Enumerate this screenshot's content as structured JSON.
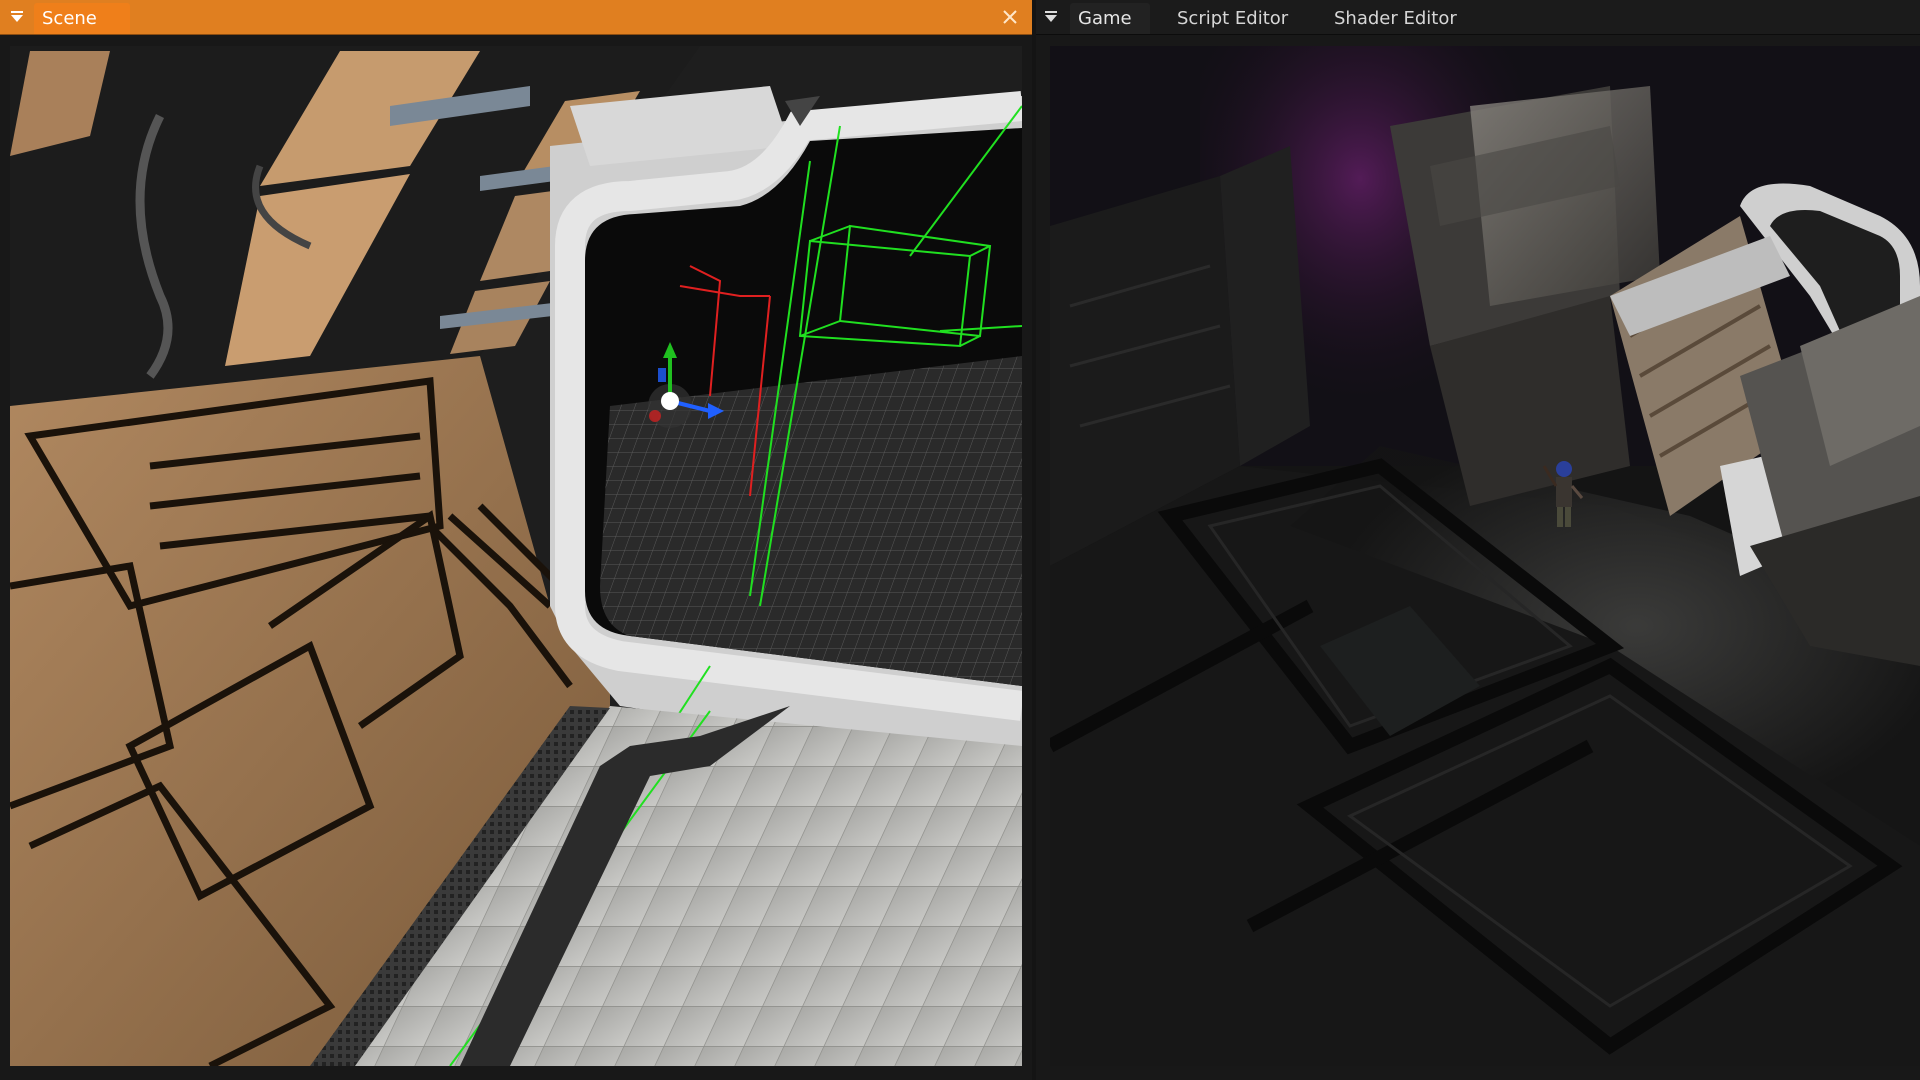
{
  "left_panel": {
    "tabs": [
      {
        "label": "Scene",
        "active": true
      }
    ],
    "close_icon": "close-icon",
    "menu_icon": "panel-menu-icon",
    "accent": "#e07f20"
  },
  "right_panel": {
    "tabs": [
      {
        "label": "Game",
        "active": true
      },
      {
        "label": "Script Editor",
        "active": false
      },
      {
        "label": "Shader Editor",
        "active": false
      }
    ],
    "menu_icon": "panel-menu-icon"
  },
  "scene_viewport": {
    "gizmo_icon": "transform-gizmo-icon",
    "gizmo_colors": {
      "x": "#2060ff",
      "y": "#20c020",
      "z": "#e02020"
    },
    "selection_color": "#20e020"
  }
}
